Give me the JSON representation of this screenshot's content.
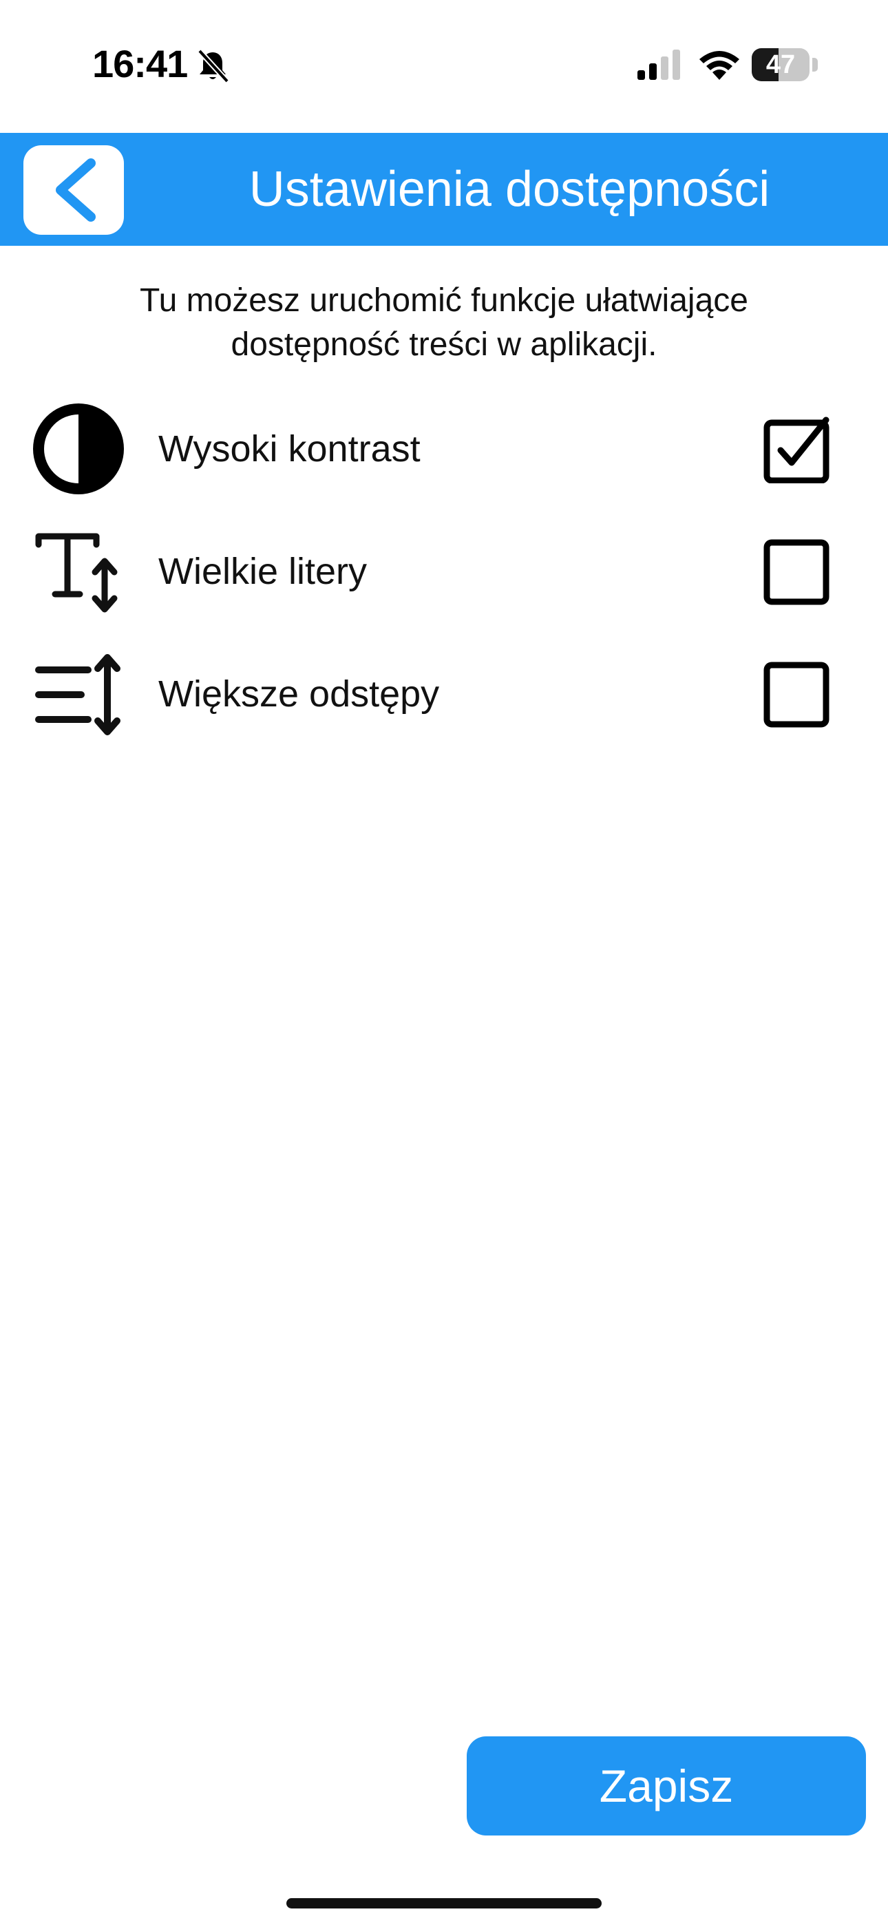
{
  "status_bar": {
    "time": "16:41",
    "battery_percent": 47,
    "battery_label": "47",
    "icons": [
      "bell-slash-icon",
      "signal-icon",
      "wifi-icon",
      "battery-icon"
    ]
  },
  "header": {
    "title": "Ustawienia dostępności",
    "back_icon": "chevron-left-icon",
    "background_color": "#2196f3"
  },
  "intro": {
    "line1": "Tu możesz uruchomić funkcje ułatwiające",
    "line2": "dostępność treści w aplikacji."
  },
  "options": [
    {
      "icon": "contrast-icon",
      "label": "Wysoki kontrast",
      "checked": true
    },
    {
      "icon": "text-size-icon",
      "label": "Wielkie litery",
      "checked": false
    },
    {
      "icon": "line-spacing-icon",
      "label": "Większe odstępy",
      "checked": false
    }
  ],
  "footer": {
    "save_label": "Zapisz",
    "button_color": "#2196f3"
  }
}
